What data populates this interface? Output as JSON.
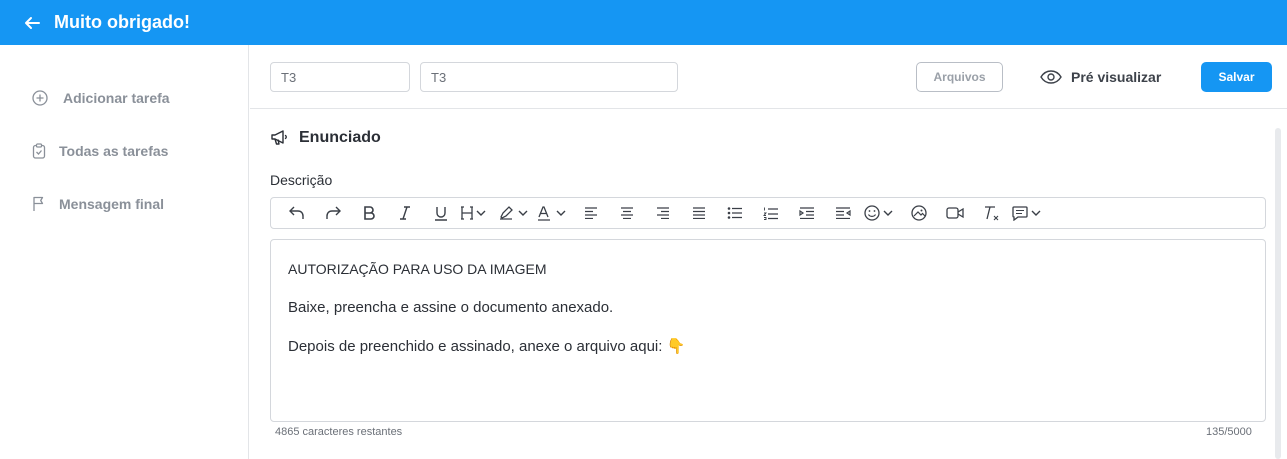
{
  "header": {
    "title": "Muito obrigado!"
  },
  "sidebar": {
    "items": [
      {
        "label": "Adicionar tarefa",
        "icon": "plus-circle-icon"
      },
      {
        "label": "Todas as tarefas",
        "icon": "clipboard-check-icon"
      },
      {
        "label": "Mensagem final",
        "icon": "flag-icon"
      }
    ]
  },
  "form": {
    "code_value": "T3",
    "title_value": "T3",
    "files_label": "Arquivos",
    "preview_label": "Pré visualizar",
    "save_label": "Salvar"
  },
  "section": {
    "title": "Enunciado",
    "description_label": "Descrição"
  },
  "editor": {
    "paragraphs": [
      "AUTORIZAÇÃO PARA USO DA IMAGEM",
      "Baixe, preencha e assine o documento anexado.",
      "Depois de preenchido e assinado, anexe o arquivo aqui:"
    ],
    "emoji": "👇",
    "remaining": "4865 caracteres restantes",
    "count": "135/5000"
  },
  "colors": {
    "brand": "#1596f3",
    "muted": "#8a9099"
  }
}
